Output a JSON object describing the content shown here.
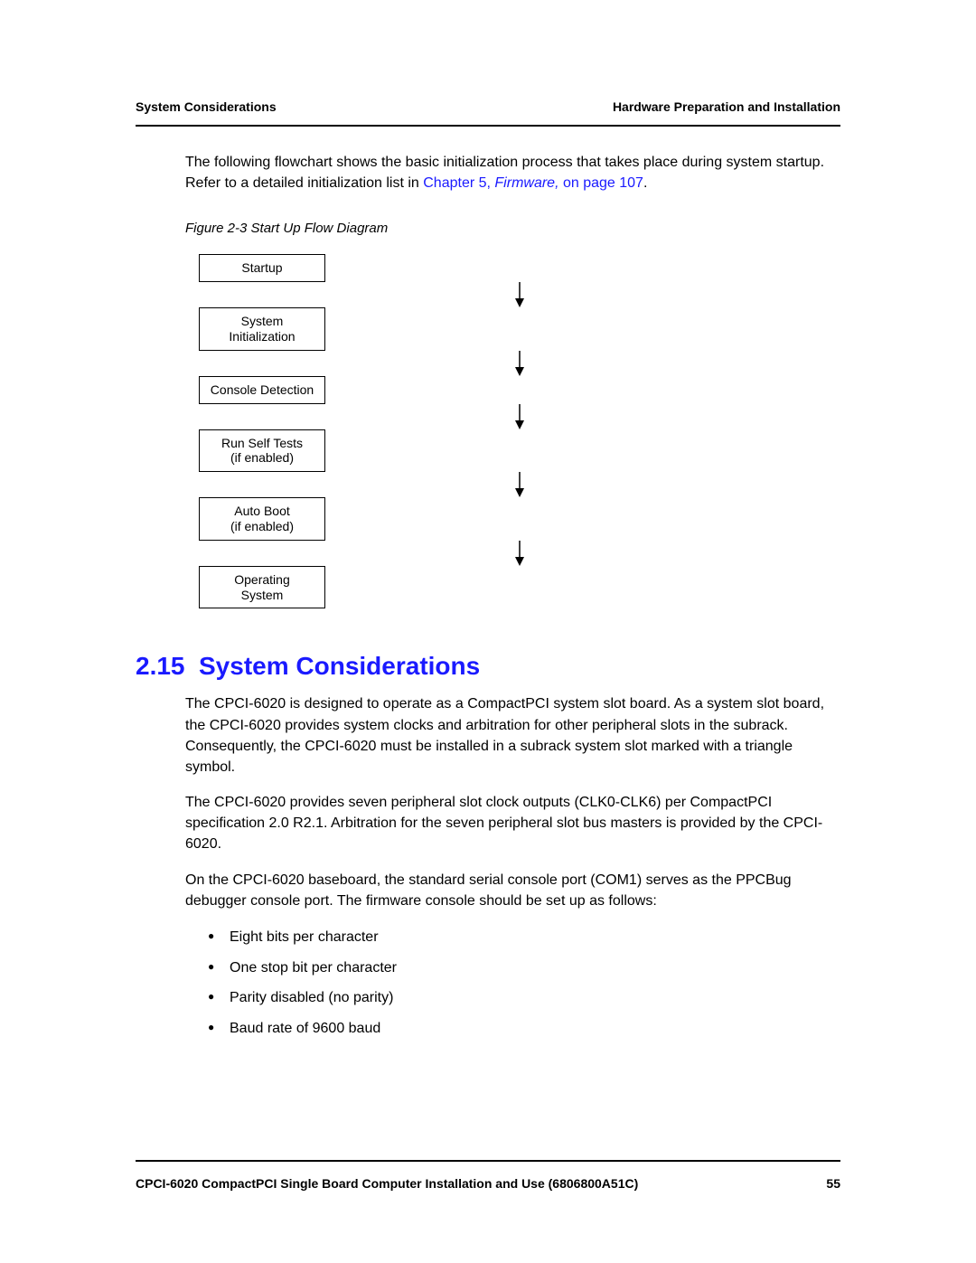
{
  "header": {
    "left": "System Considerations",
    "right": "Hardware Preparation and Installation"
  },
  "intro": {
    "pre": "The following flowchart shows the basic initialization process that takes place during system startup. Refer to a detailed initialization list in ",
    "link1": "Chapter 5, ",
    "link2": "Firmware,",
    "link3": " on page 107",
    "end": "."
  },
  "figure": {
    "caption": "Figure 2-3    Start Up Flow Diagram",
    "boxes": [
      "Startup",
      "System\nInitialization",
      "Console Detection",
      "Run Self Tests\n(if enabled)",
      "Auto Boot\n(if enabled)",
      "Operating\nSystem"
    ]
  },
  "section": {
    "number": "2.15",
    "title": "System Considerations",
    "p1": "The CPCI-6020 is designed to operate as a CompactPCI system slot board. As a system slot board, the CPCI-6020 provides system clocks and arbitration for other peripheral slots in the subrack. Consequently, the CPCI-6020 must be installed in a subrack system slot marked with a triangle symbol.",
    "p2": "The CPCI-6020 provides seven peripheral slot clock outputs (CLK0-CLK6) per CompactPCI specification 2.0 R2.1. Arbitration for the seven peripheral slot bus masters is provided by the CPCI-6020.",
    "p3": "On the CPCI-6020 baseboard, the standard serial console port (COM1) serves as the PPCBug debugger console port. The firmware console should be set up as follows:",
    "bullets": [
      "Eight bits per character",
      "One stop bit per character",
      "Parity disabled (no parity)",
      "Baud rate of 9600 baud"
    ]
  },
  "footer": {
    "left": "CPCI-6020 CompactPCI Single Board Computer Installation and Use (6806800A51C)",
    "right": "55"
  }
}
